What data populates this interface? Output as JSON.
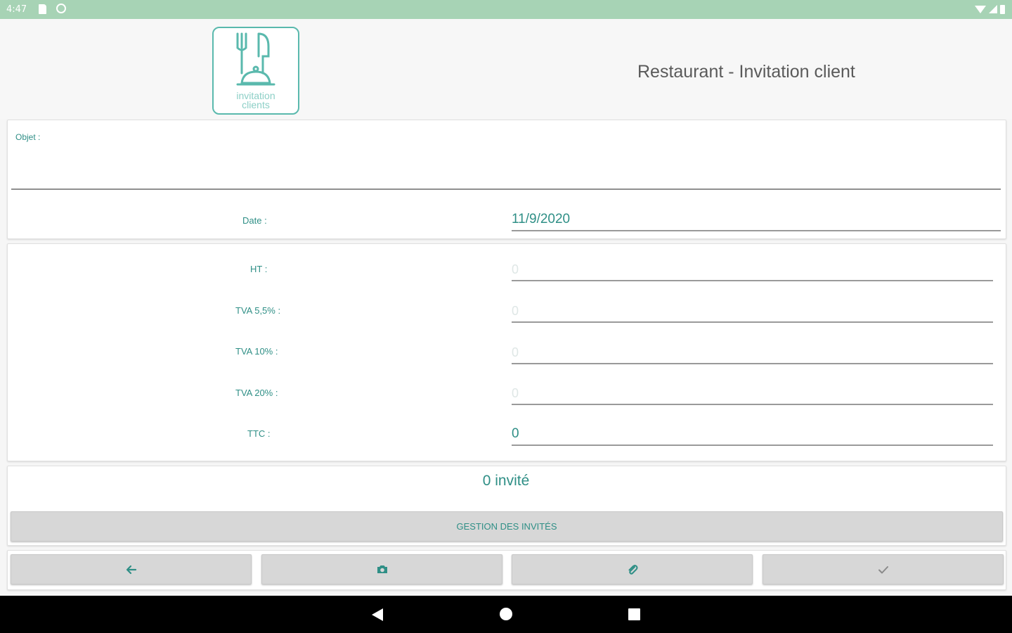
{
  "status_bar": {
    "time": "4:47"
  },
  "header": {
    "logo_text_line1": "invitation",
    "logo_text_line2": "clients",
    "title": "Restaurant - Invitation client"
  },
  "form": {
    "objet": {
      "label": "Objet :",
      "value": ""
    },
    "date": {
      "label": "Date :",
      "value": "11/9/2020"
    },
    "amounts": [
      {
        "label": "HT :",
        "placeholder": "0",
        "value": ""
      },
      {
        "label": "TVA 5,5% :",
        "placeholder": "0",
        "value": ""
      },
      {
        "label": "TVA 10% :",
        "placeholder": "0",
        "value": ""
      },
      {
        "label": "TVA 20% :",
        "placeholder": "0",
        "value": ""
      },
      {
        "label": "TTC :",
        "placeholder": "",
        "value": "0"
      }
    ]
  },
  "guests": {
    "count_text": "0 invité",
    "manage_button": "GESTION DES INVITÉS"
  },
  "actions": [
    {
      "name": "back",
      "icon": "arrow-left-icon"
    },
    {
      "name": "photo",
      "icon": "camera-icon"
    },
    {
      "name": "attach",
      "icon": "paperclip-icon"
    },
    {
      "name": "validate",
      "icon": "check-icon"
    }
  ],
  "colors": {
    "accent": "#2f8f86",
    "status_bar": "#a7d3b5",
    "logo_border": "#5ab9ad"
  }
}
